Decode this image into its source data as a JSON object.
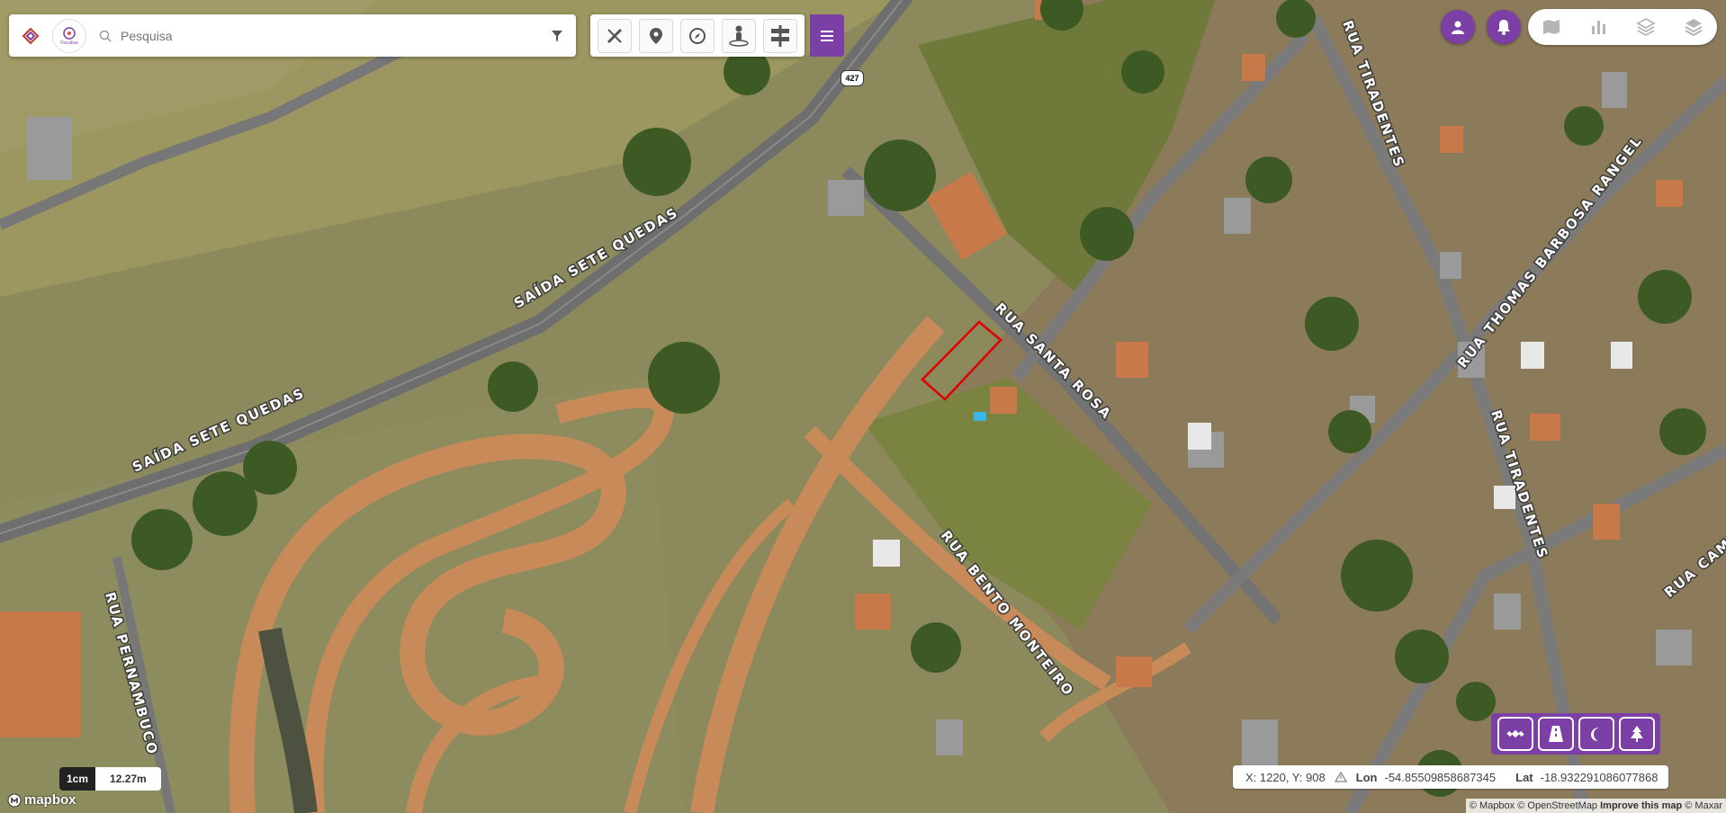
{
  "search": {
    "placeholder": "Pesquisa"
  },
  "logo": {
    "text": "Fiscaliza"
  },
  "toolbar": {
    "tools": [
      "ruler-pencil-icon",
      "location-pin-icon",
      "compass-icon",
      "street-view-icon",
      "signpost-icon"
    ],
    "menu_icon": "hamburger-icon"
  },
  "top_right": {
    "user_icon": "user-icon",
    "bell_icon": "bell-icon",
    "layers": [
      "map-icon",
      "bar-chart-icon",
      "layers-outline-icon",
      "layers-filled-icon"
    ]
  },
  "map_styles": [
    "satellite-icon",
    "road-icon",
    "night-icon",
    "terrain-icon"
  ],
  "streets": {
    "saida_sete_quedas_1": "SAÍDA SETE QUEDAS",
    "saida_sete_quedas_2": "SAÍDA SETE QUEDAS",
    "rua_santa_rosa": "RUA SANTA ROSA",
    "rua_bento_monteiro": "RUA BENTO MONTEIRO",
    "rua_tiradentes_1": "RUA TIRADENTES",
    "rua_tiradentes_2": "RUA TIRADENTES",
    "rua_thomas": "RUA THOMAS BARBOSA RANGEL",
    "rua_pernambuco": "RUA PERNAMBUCO",
    "rua_campo": "RUA CAMPO"
  },
  "route_shield": "427",
  "coords": {
    "xy": "X: 1220, Y: 908",
    "lon_label": "Lon",
    "lon_value": "-54.85509858687345",
    "lat_label": "Lat",
    "lat_value": "-18.932291086077868"
  },
  "scale": {
    "unit": "1cm",
    "value": "12.27m"
  },
  "attribution": {
    "mapbox": "© Mapbox",
    "osm": "© OpenStreetMap",
    "improve": "Improve this map",
    "maxar": "© Maxar"
  },
  "mapbox_logo": "mapbox",
  "colors": {
    "accent": "#7b3fa6",
    "selection": "#e00000",
    "dirt_road": "#c98a5a",
    "paved_road": "#6e6e6e",
    "grass": "#8b8f55"
  }
}
